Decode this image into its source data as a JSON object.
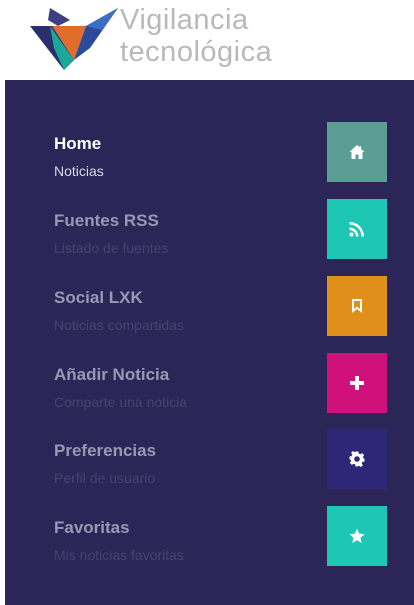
{
  "brand": {
    "line1": "Vigilancia",
    "line2": "tecnológica"
  },
  "menu": [
    {
      "title": "Home",
      "subtitle": "Noticias",
      "icon": "home-icon",
      "color": "#5a9e94",
      "active": true
    },
    {
      "title": "Fuentes RSS",
      "subtitle": "Listado de fuentes",
      "icon": "rss-icon",
      "color": "#1ec7b3",
      "active": false
    },
    {
      "title": "Social LXK",
      "subtitle": "Noticias compartidas",
      "icon": "bookmark-icon",
      "color": "#e08f1b",
      "active": false
    },
    {
      "title": "Añadir Noticia",
      "subtitle": "Comparte una noticia",
      "icon": "plus-icon",
      "color": "#d0117c",
      "active": false
    },
    {
      "title": "Preferencias",
      "subtitle": "Perfil de usuario",
      "icon": "gear-icon",
      "color": "#2e2677",
      "active": false
    },
    {
      "title": "Favoritas",
      "subtitle": "Mis noticias favoritas",
      "icon": "star-icon",
      "color": "#1ec7b3",
      "active": false
    }
  ]
}
